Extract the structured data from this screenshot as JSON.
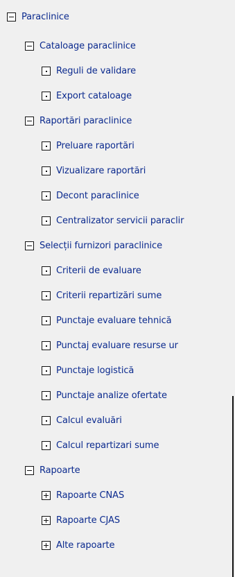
{
  "tree": {
    "root": {
      "label": "Paraclinice",
      "state": "expanded",
      "children": [
        {
          "label": "Cataloage paraclinice",
          "state": "expanded",
          "children": [
            {
              "label": "Reguli de validare"
            },
            {
              "label": "Export cataloage"
            }
          ]
        },
        {
          "label": "Raportări paraclinice",
          "state": "expanded",
          "children": [
            {
              "label": "Preluare raportări"
            },
            {
              "label": "Vizualizare raportări"
            },
            {
              "label": "Decont paraclinice"
            },
            {
              "label": "Centralizator servicii paraclir"
            }
          ]
        },
        {
          "label": "Selecții furnizori paraclinice",
          "state": "expanded",
          "children": [
            {
              "label": "Criterii de evaluare"
            },
            {
              "label": "Criterii repartizări sume"
            },
            {
              "label": "Punctaje evaluare tehnică"
            },
            {
              "label": "Punctaj evaluare resurse ur"
            },
            {
              "label": "Punctaje logistică"
            },
            {
              "label": "Punctaje analize ofertate"
            },
            {
              "label": "Calcul evaluări"
            },
            {
              "label": "Calcul repartizari sume"
            }
          ]
        },
        {
          "label": "Rapoarte",
          "state": "expanded",
          "children": [
            {
              "label": "Rapoarte CNAS",
              "state": "collapsed"
            },
            {
              "label": "Rapoarte CJAS",
              "state": "collapsed"
            },
            {
              "label": "Alte rapoarte",
              "state": "collapsed"
            }
          ]
        }
      ]
    }
  },
  "icons": {
    "expanded": "collapse-minus-icon",
    "collapsed": "expand-plus-icon",
    "leaf": "leaf-dot-icon"
  },
  "colors": {
    "background": "#f0f0f0",
    "text": "#0b2a8e",
    "box_border": "#111111",
    "box_fill": "#ffffff"
  }
}
